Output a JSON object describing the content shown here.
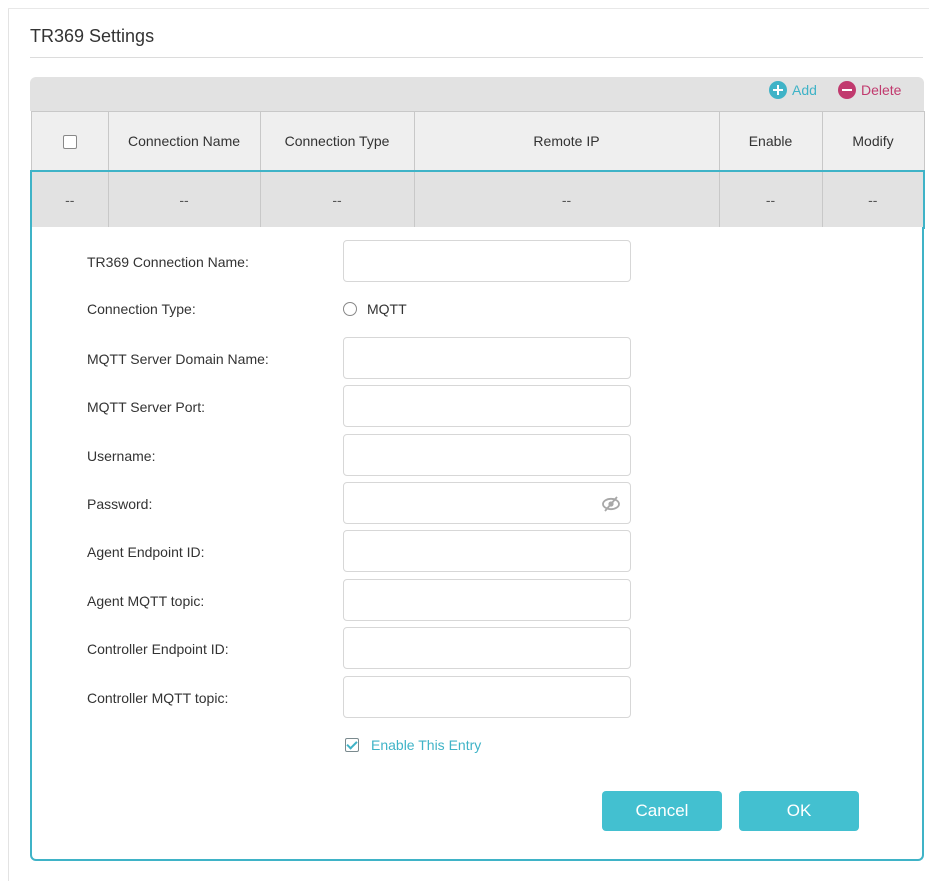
{
  "page": {
    "title": "TR369 Settings"
  },
  "toolbar": {
    "add_label": "Add",
    "delete_label": "Delete"
  },
  "table": {
    "columns": [
      "Connection Name",
      "Connection Type",
      "Remote IP",
      "Enable",
      "Modify"
    ],
    "rows": [
      [
        "--",
        "--",
        "--",
        "--",
        "--",
        "--"
      ]
    ]
  },
  "form": {
    "connection_name_label": "TR369 Connection Name:",
    "connection_type_label": "Connection Type:",
    "connection_type_option": "MQTT",
    "server_domain_label": "MQTT Server Domain Name:",
    "server_port_label": "MQTT Server Port:",
    "username_label": "Username:",
    "password_label": "Password:",
    "agent_endpoint_label": "Agent Endpoint ID:",
    "agent_topic_label": "Agent MQTT topic:",
    "controller_endpoint_label": "Controller Endpoint ID:",
    "controller_topic_label": "Controller MQTT topic:",
    "enable_entry_label": "Enable This Entry",
    "cancel_label": "Cancel",
    "ok_label": "OK"
  },
  "colors": {
    "accent": "#3fb3c7",
    "delete": "#c13a6e",
    "button": "#43c0d0"
  },
  "icons": {
    "add": "plus-circle-icon",
    "delete": "minus-circle-icon",
    "password_toggle": "eye-slash-icon"
  }
}
